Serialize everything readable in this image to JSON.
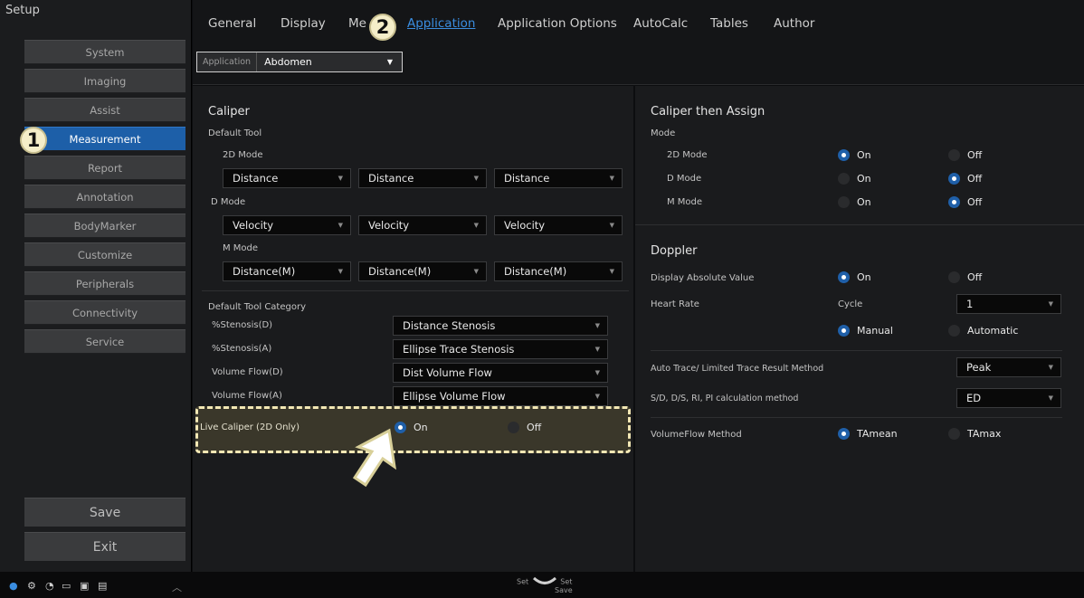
{
  "sidebar": {
    "title": "Setup",
    "items": [
      "System",
      "Imaging",
      "Assist",
      "Measurement",
      "Report",
      "Annotation",
      "BodyMarker",
      "Customize",
      "Peripherals",
      "Connectivity",
      "Service"
    ],
    "active_item": "Measurement",
    "save_label": "Save",
    "exit_label": "Exit"
  },
  "tabs": [
    "General",
    "Display",
    "Me",
    "Application",
    "Application Options",
    "AutoCalc",
    "Tables",
    "Author"
  ],
  "active_tab": "Application",
  "application": {
    "label": "Application",
    "value": "Abdomen"
  },
  "caliper": {
    "heading": "Caliper",
    "default_tool": "Default Tool",
    "modes": [
      {
        "label": "2D Mode",
        "values": [
          "Distance",
          "Distance",
          "Distance"
        ]
      },
      {
        "label": "D Mode",
        "values": [
          "Velocity",
          "Velocity",
          "Velocity"
        ]
      },
      {
        "label": "M Mode",
        "values": [
          "Distance(M)",
          "Distance(M)",
          "Distance(M)"
        ]
      }
    ],
    "category_heading": "Default Tool Category",
    "categories": [
      {
        "label": "%Stenosis(D)",
        "value": "Distance Stenosis"
      },
      {
        "label": "%Stenosis(A)",
        "value": "Ellipse Trace Stenosis"
      },
      {
        "label": "Volume Flow(D)",
        "value": "Dist Volume Flow"
      },
      {
        "label": "Volume Flow(A)",
        "value": "Ellipse Volume Flow"
      }
    ],
    "live_caliper": {
      "label": "Live Caliper (2D Only)",
      "on": "On",
      "off": "Off",
      "selected": "On"
    }
  },
  "caliper_assign": {
    "heading": "Caliper then Assign",
    "mode_label": "Mode",
    "rows": [
      {
        "label": "2D Mode",
        "on": "On",
        "off": "Off",
        "selected": "On"
      },
      {
        "label": "D Mode",
        "on": "On",
        "off": "Off",
        "selected": "Off"
      },
      {
        "label": "M Mode",
        "on": "On",
        "off": "Off",
        "selected": "Off"
      }
    ]
  },
  "doppler": {
    "heading": "Doppler",
    "display_absolute": {
      "label": "Display Absolute Value",
      "on": "On",
      "off": "Off",
      "selected": "On"
    },
    "heart_rate": {
      "label": "Heart Rate",
      "cycle_label": "Cycle",
      "cycle_value": "1",
      "manual": "Manual",
      "automatic": "Automatic",
      "selected": "Manual"
    },
    "auto_trace": {
      "label": "Auto Trace/ Limited Trace Result Method",
      "value": "Peak"
    },
    "sd_calc": {
      "label": "S/D, D/S, RI, PI calculation method",
      "value": "ED"
    },
    "volumeflow": {
      "label": "VolumeFlow Method",
      "tamean": "TAmean",
      "tamax": "TAmax",
      "selected": "TAmean"
    }
  },
  "badges": [
    "1",
    "2"
  ],
  "bottom": {
    "set_left": "Set",
    "set_right": "Set",
    "save": "Save"
  },
  "colors": {
    "accent": "#1d5fa8",
    "highlight": "#f2e7b4"
  }
}
